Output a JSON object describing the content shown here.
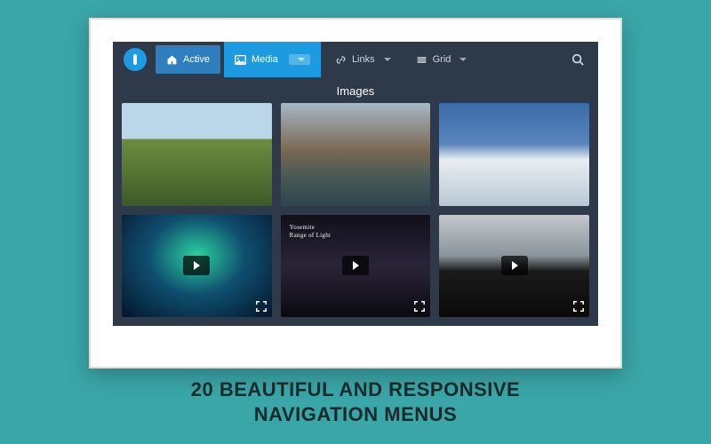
{
  "nav": {
    "items": [
      {
        "label": "Active",
        "icon": "home",
        "dropdown": false,
        "state": "active"
      },
      {
        "label": "Media",
        "icon": "image",
        "dropdown": true,
        "state": "selected"
      },
      {
        "label": "Links",
        "icon": "link",
        "dropdown": true,
        "state": "normal"
      },
      {
        "label": "Grid",
        "icon": "grid",
        "dropdown": true,
        "state": "normal"
      }
    ]
  },
  "section": {
    "title": "Images"
  },
  "gallery": {
    "items": [
      {
        "kind": "image",
        "scene": "hills"
      },
      {
        "kind": "image",
        "scene": "coast"
      },
      {
        "kind": "image",
        "scene": "snow"
      },
      {
        "kind": "video",
        "scene": "aurora"
      },
      {
        "kind": "video",
        "scene": "falls",
        "caption_line1": "Yosemite",
        "caption_line2": "Range of Light"
      },
      {
        "kind": "video",
        "scene": "black"
      }
    ]
  },
  "headline": {
    "line1": "20 BEAUTIFUL AND RESPONSIVE",
    "line2": "NAVIGATION MENUS"
  },
  "colors": {
    "panel": "#2e3a4a",
    "accent": "#1d9be0",
    "page": "#3aa6a8"
  }
}
